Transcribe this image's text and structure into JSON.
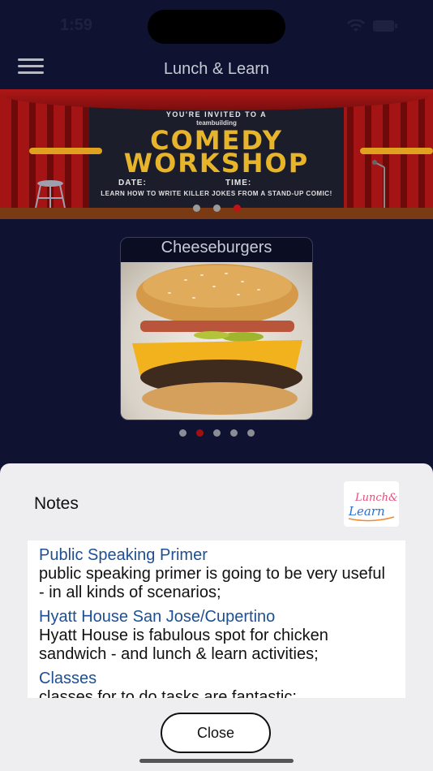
{
  "status_bar": {
    "time": "1:59"
  },
  "nav": {
    "title": "Lunch & Learn"
  },
  "banner": {
    "invite_line": "YOU'RE INVITED TO A",
    "brand": "teambuilding",
    "title_line1": "COMEDY",
    "title_line2": "WORKSHOP",
    "date_label": "DATE:",
    "time_label": "TIME:",
    "description": "LEARN HOW TO WRITE KILLER JOKES FROM A STAND-UP COMIC!",
    "slides": 3,
    "active_slide": 3
  },
  "food_card": {
    "title": "Cheeseburgers",
    "slides": 5,
    "active_slide": 2
  },
  "sheet": {
    "title": "Notes",
    "logo_text": [
      "Lunch&",
      "Learn"
    ],
    "notes": [
      {
        "title": "Public Speaking Primer",
        "body": "public speaking primer is going to be very useful - in all kinds of scenarios;"
      },
      {
        "title": "Hyatt House San Jose/Cupertino",
        "body": "Hyatt House is fabulous spot for chicken sandwich - and lunch & learn activities;"
      },
      {
        "title": "Classes",
        "body": "classes for to do tasks are fantastic;"
      }
    ],
    "close_label": "Close"
  },
  "colors": {
    "background": "#0f1230",
    "accent_red": "#c01414",
    "banner_gold": "#e8b52a",
    "note_title": "#1e4f92"
  }
}
